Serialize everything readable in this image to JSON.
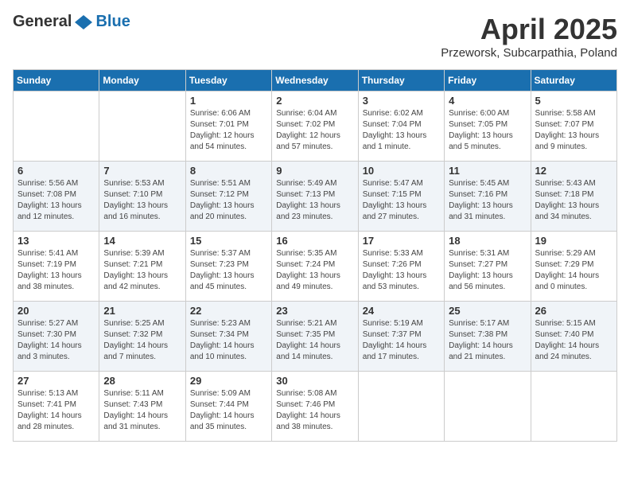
{
  "header": {
    "logo_general": "General",
    "logo_blue": "Blue",
    "month_title": "April 2025",
    "location": "Przeworsk, Subcarpathia, Poland"
  },
  "days_of_week": [
    "Sunday",
    "Monday",
    "Tuesday",
    "Wednesday",
    "Thursday",
    "Friday",
    "Saturday"
  ],
  "weeks": [
    [
      {
        "day": "",
        "info": ""
      },
      {
        "day": "",
        "info": ""
      },
      {
        "day": "1",
        "info": "Sunrise: 6:06 AM\nSunset: 7:01 PM\nDaylight: 12 hours\nand 54 minutes."
      },
      {
        "day": "2",
        "info": "Sunrise: 6:04 AM\nSunset: 7:02 PM\nDaylight: 12 hours\nand 57 minutes."
      },
      {
        "day": "3",
        "info": "Sunrise: 6:02 AM\nSunset: 7:04 PM\nDaylight: 13 hours\nand 1 minute."
      },
      {
        "day": "4",
        "info": "Sunrise: 6:00 AM\nSunset: 7:05 PM\nDaylight: 13 hours\nand 5 minutes."
      },
      {
        "day": "5",
        "info": "Sunrise: 5:58 AM\nSunset: 7:07 PM\nDaylight: 13 hours\nand 9 minutes."
      }
    ],
    [
      {
        "day": "6",
        "info": "Sunrise: 5:56 AM\nSunset: 7:08 PM\nDaylight: 13 hours\nand 12 minutes."
      },
      {
        "day": "7",
        "info": "Sunrise: 5:53 AM\nSunset: 7:10 PM\nDaylight: 13 hours\nand 16 minutes."
      },
      {
        "day": "8",
        "info": "Sunrise: 5:51 AM\nSunset: 7:12 PM\nDaylight: 13 hours\nand 20 minutes."
      },
      {
        "day": "9",
        "info": "Sunrise: 5:49 AM\nSunset: 7:13 PM\nDaylight: 13 hours\nand 23 minutes."
      },
      {
        "day": "10",
        "info": "Sunrise: 5:47 AM\nSunset: 7:15 PM\nDaylight: 13 hours\nand 27 minutes."
      },
      {
        "day": "11",
        "info": "Sunrise: 5:45 AM\nSunset: 7:16 PM\nDaylight: 13 hours\nand 31 minutes."
      },
      {
        "day": "12",
        "info": "Sunrise: 5:43 AM\nSunset: 7:18 PM\nDaylight: 13 hours\nand 34 minutes."
      }
    ],
    [
      {
        "day": "13",
        "info": "Sunrise: 5:41 AM\nSunset: 7:19 PM\nDaylight: 13 hours\nand 38 minutes."
      },
      {
        "day": "14",
        "info": "Sunrise: 5:39 AM\nSunset: 7:21 PM\nDaylight: 13 hours\nand 42 minutes."
      },
      {
        "day": "15",
        "info": "Sunrise: 5:37 AM\nSunset: 7:23 PM\nDaylight: 13 hours\nand 45 minutes."
      },
      {
        "day": "16",
        "info": "Sunrise: 5:35 AM\nSunset: 7:24 PM\nDaylight: 13 hours\nand 49 minutes."
      },
      {
        "day": "17",
        "info": "Sunrise: 5:33 AM\nSunset: 7:26 PM\nDaylight: 13 hours\nand 53 minutes."
      },
      {
        "day": "18",
        "info": "Sunrise: 5:31 AM\nSunset: 7:27 PM\nDaylight: 13 hours\nand 56 minutes."
      },
      {
        "day": "19",
        "info": "Sunrise: 5:29 AM\nSunset: 7:29 PM\nDaylight: 14 hours\nand 0 minutes."
      }
    ],
    [
      {
        "day": "20",
        "info": "Sunrise: 5:27 AM\nSunset: 7:30 PM\nDaylight: 14 hours\nand 3 minutes."
      },
      {
        "day": "21",
        "info": "Sunrise: 5:25 AM\nSunset: 7:32 PM\nDaylight: 14 hours\nand 7 minutes."
      },
      {
        "day": "22",
        "info": "Sunrise: 5:23 AM\nSunset: 7:34 PM\nDaylight: 14 hours\nand 10 minutes."
      },
      {
        "day": "23",
        "info": "Sunrise: 5:21 AM\nSunset: 7:35 PM\nDaylight: 14 hours\nand 14 minutes."
      },
      {
        "day": "24",
        "info": "Sunrise: 5:19 AM\nSunset: 7:37 PM\nDaylight: 14 hours\nand 17 minutes."
      },
      {
        "day": "25",
        "info": "Sunrise: 5:17 AM\nSunset: 7:38 PM\nDaylight: 14 hours\nand 21 minutes."
      },
      {
        "day": "26",
        "info": "Sunrise: 5:15 AM\nSunset: 7:40 PM\nDaylight: 14 hours\nand 24 minutes."
      }
    ],
    [
      {
        "day": "27",
        "info": "Sunrise: 5:13 AM\nSunset: 7:41 PM\nDaylight: 14 hours\nand 28 minutes."
      },
      {
        "day": "28",
        "info": "Sunrise: 5:11 AM\nSunset: 7:43 PM\nDaylight: 14 hours\nand 31 minutes."
      },
      {
        "day": "29",
        "info": "Sunrise: 5:09 AM\nSunset: 7:44 PM\nDaylight: 14 hours\nand 35 minutes."
      },
      {
        "day": "30",
        "info": "Sunrise: 5:08 AM\nSunset: 7:46 PM\nDaylight: 14 hours\nand 38 minutes."
      },
      {
        "day": "",
        "info": ""
      },
      {
        "day": "",
        "info": ""
      },
      {
        "day": "",
        "info": ""
      }
    ]
  ]
}
